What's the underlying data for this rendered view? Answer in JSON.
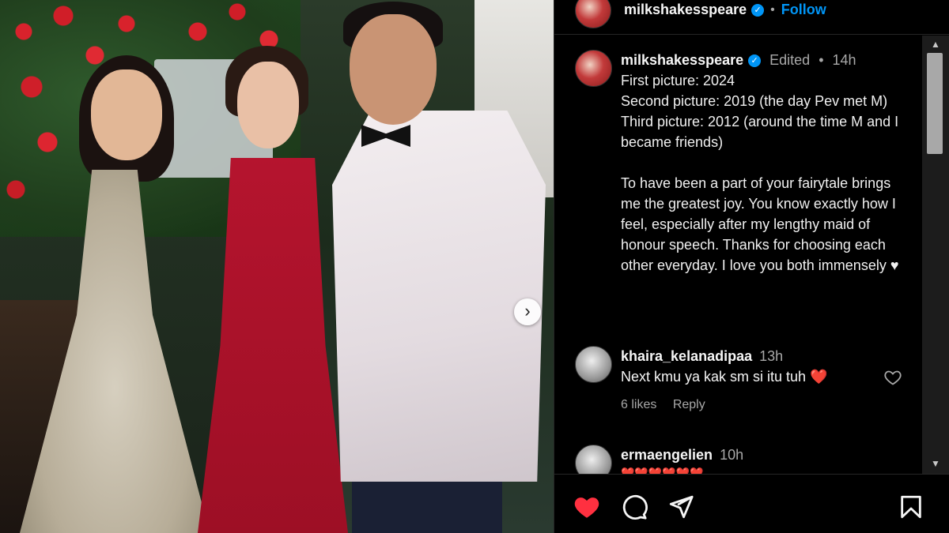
{
  "post": {
    "header": {
      "username": "milkshakesspeare",
      "separator": "•",
      "follow_label": "Follow"
    },
    "caption": {
      "username": "milkshakesspeare",
      "edited_label": "Edited",
      "separator": "•",
      "time": "14h",
      "lines": [
        "First picture: 2024",
        "Second picture: 2019 (the day Pev met M)",
        "Third picture: 2012 (around the time M and I became friends)"
      ],
      "paragraph": "To have been a part of your fairytale brings me the greatest joy. You know exactly how I feel, especially after my lengthy maid of honour speech. Thanks for choosing each other everyday. I love you both immensely ♥"
    },
    "comments": [
      {
        "username": "khaira_kelanadipaa",
        "time": "13h",
        "text": "Next kmu ya kak sm si itu tuh",
        "emoji": "❤️",
        "likes": "6 likes",
        "reply_label": "Reply"
      },
      {
        "username": "ermaengelien",
        "time": "10h",
        "text": "❤️❤️❤️❤️❤️❤️"
      }
    ]
  },
  "colors": {
    "accent_blue": "#0095f6",
    "like_red": "#ff3040",
    "background": "#000000",
    "muted_text": "#a8a8a8"
  },
  "icons": {
    "carousel_next": "chevron-right-icon",
    "verified": "verified-badge-icon",
    "like": "heart-icon",
    "comment": "comment-bubble-icon",
    "share": "paper-plane-icon",
    "save": "bookmark-icon",
    "scroll_up": "triangle-up-icon",
    "scroll_down": "triangle-down-icon"
  },
  "glyphs": {
    "carousel_next": "›",
    "verified": "✓",
    "scroll_up": "▲",
    "scroll_down": "▼"
  },
  "state": {
    "post_liked": true
  }
}
